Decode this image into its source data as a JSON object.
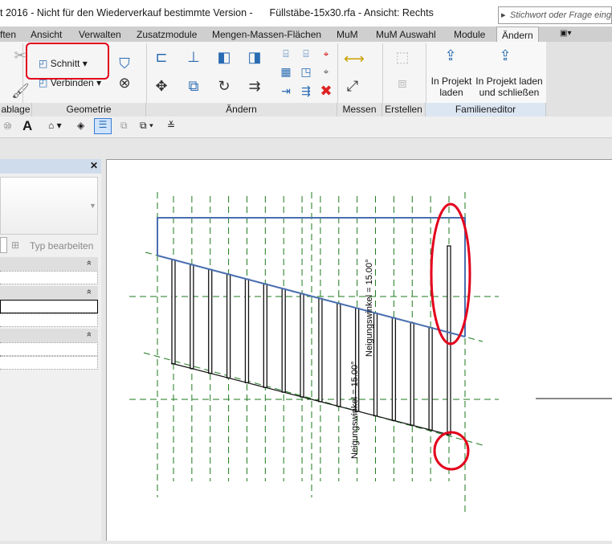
{
  "titlebar": {
    "title": "t 2016 - Nicht für den Wiederverkauf bestimmte Version -      Füllstäbe-15x30.rfa - Ansicht: Rechts",
    "search_placeholder": "Stichwort oder Frage eingeben"
  },
  "tabs": [
    "ften",
    "Ansicht",
    "Verwalten",
    "Zusatzmodule",
    "Mengen-Massen-Flächen",
    "MuM",
    "MuM Auswahl",
    "Module",
    "Ändern"
  ],
  "ribbon": {
    "panels": [
      "ablage",
      "Geometrie",
      "Ändern",
      "Messen",
      "Erstellen",
      "Familieneditor"
    ],
    "schnitt": "Schnitt",
    "verbinden": "Verbinden",
    "load_into_project": [
      "In Projekt",
      "laden"
    ],
    "load_and_close": [
      "In Projekt laden",
      "und schließen"
    ]
  },
  "properties": {
    "edit_type": "Typ bearbeiten",
    "collapse": "»"
  },
  "drawing": {
    "dimension_1": "Neigungswinkel = 15.00°",
    "dimension_2": "Neigungswinkel = 15.00°",
    "bar_count": 16,
    "highlight_color": "#e3001b",
    "ref_plane_color": "#1e7a1e",
    "sketch_color": "#4a6fb0"
  }
}
